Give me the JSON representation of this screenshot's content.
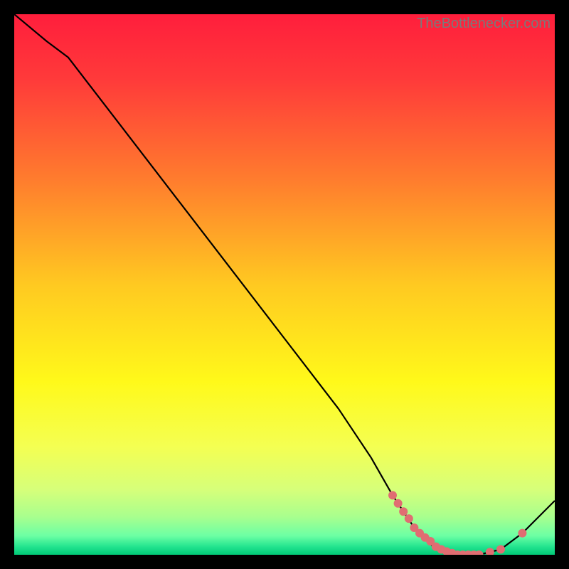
{
  "watermark": "TheBottlenecker.com",
  "chart_data": {
    "type": "line",
    "title": "",
    "xlabel": "",
    "ylabel": "",
    "xlim": [
      0,
      100
    ],
    "ylim": [
      0,
      100
    ],
    "series": [
      {
        "name": "curve",
        "x": [
          0,
          6,
          10,
          20,
          30,
          40,
          50,
          60,
          66,
          70,
          74,
          78,
          82,
          86,
          90,
          94,
          100
        ],
        "y": [
          100,
          95,
          92,
          79,
          66,
          53,
          40,
          27,
          18,
          11,
          5,
          1,
          0,
          0,
          1,
          4,
          10
        ]
      }
    ],
    "markers": {
      "name": "highlight-dots",
      "x": [
        70,
        71,
        72,
        73,
        74,
        75,
        76,
        77,
        78,
        79,
        80,
        81,
        82,
        83,
        84,
        85,
        86,
        88,
        90,
        94
      ],
      "y": [
        11,
        9.5,
        8,
        6.7,
        5,
        4,
        3.2,
        2.5,
        1.5,
        1,
        0.6,
        0.3,
        0,
        0,
        0,
        0,
        0,
        0.5,
        1,
        4
      ]
    },
    "gradient_stops": [
      {
        "offset": 0.0,
        "color": "#ff1e3c"
      },
      {
        "offset": 0.12,
        "color": "#ff3a3a"
      },
      {
        "offset": 0.3,
        "color": "#ff7a2e"
      },
      {
        "offset": 0.5,
        "color": "#ffc921"
      },
      {
        "offset": 0.68,
        "color": "#fff91a"
      },
      {
        "offset": 0.8,
        "color": "#f4ff52"
      },
      {
        "offset": 0.88,
        "color": "#d6ff7a"
      },
      {
        "offset": 0.93,
        "color": "#a8ff8e"
      },
      {
        "offset": 0.965,
        "color": "#6cffa4"
      },
      {
        "offset": 0.985,
        "color": "#23e48f"
      },
      {
        "offset": 1.0,
        "color": "#00c977"
      }
    ],
    "marker_color": "#e06d72",
    "line_color": "#000000"
  }
}
